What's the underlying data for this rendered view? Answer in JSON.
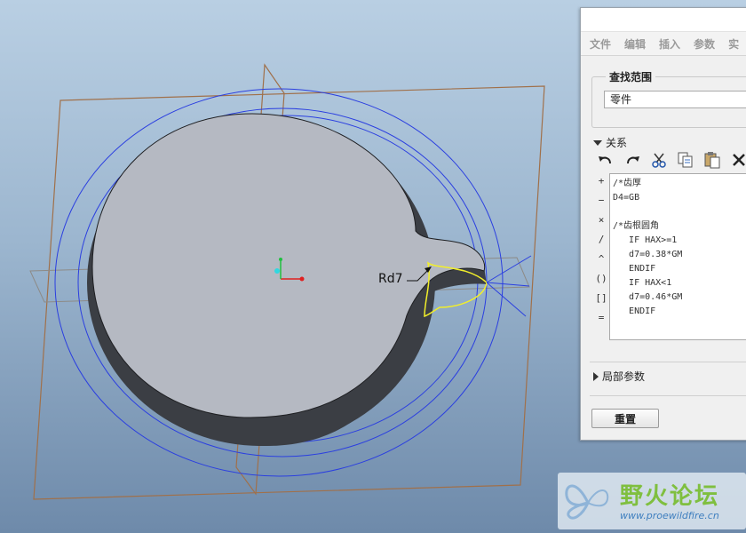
{
  "viewport": {
    "dimension_label": "Rd7"
  },
  "dialog": {
    "menu": [
      "文件",
      "编辑",
      "插入",
      "参数",
      "实"
    ],
    "search_scope": {
      "title": "查找范围",
      "value": "零件"
    },
    "relations": {
      "header": "关系",
      "operators": [
        "+",
        "−",
        "×",
        "/",
        "^",
        "()",
        "[]",
        "="
      ],
      "lines": [
        "/*齿厚",
        "D4=GB",
        "",
        "/*齿根圆角",
        "   IF HAX>=1",
        "   d7=0.38*GM",
        "   ENDIF",
        "   IF HAX<1",
        "   d7=0.46*GM",
        "   ENDIF"
      ]
    },
    "local_params_header": "局部参数",
    "reset_label": "重置"
  },
  "watermark": {
    "title": "野火论坛",
    "url": "www.proewildfire.cn"
  },
  "colors": {
    "datum_plane": "#a0704a",
    "sketch_circle": "#2b3fe0",
    "highlight": "#f2ef2a",
    "part_face": "#b5b9c2",
    "part_side": "#3b3e44"
  }
}
